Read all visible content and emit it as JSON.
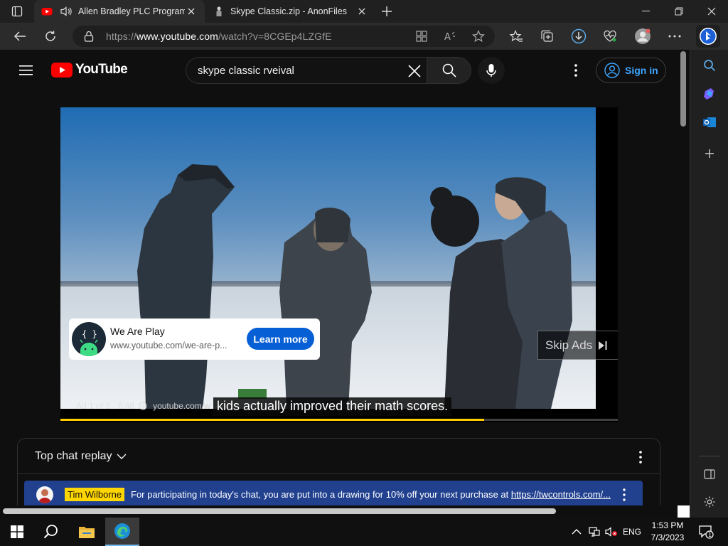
{
  "browser": {
    "tabs": [
      {
        "title": "Allen Bradley PLC Programmi",
        "active": true,
        "audio": true
      },
      {
        "title": "Skype Classic.zip - AnonFiles",
        "active": false
      }
    ],
    "url": {
      "scheme": "https://",
      "host": "www.youtube.com",
      "path": "/watch?v=8CGEp4LZGfE"
    }
  },
  "youtube": {
    "logo_text": "YouTube",
    "search_query": "skype classic rveival",
    "signin_label": "Sign in"
  },
  "player": {
    "ad_card": {
      "name": "We Are Play",
      "link": "www.youtube.com/we-are-p...",
      "button": "Learn more"
    },
    "skip_label": "Skip Ads",
    "ad_counter": "Ad 1 of 2 · 0:46",
    "ad_domain": "youtube.com/w",
    "caption": "kids actually improved their math scores.",
    "progress_fraction": 0.76
  },
  "chat": {
    "header": "Top chat replay",
    "pinned": {
      "author": "Tim Wilborne",
      "message": "For participating in today's chat, you are put into a drawing for 10% off your next purchase at ",
      "link": "https://twcontrols.com/..."
    }
  },
  "taskbar": {
    "lang": "ENG",
    "time": "1:53 PM",
    "date": "7/3/2023",
    "notification_count": "1"
  },
  "colors": {
    "accent": "#3ea6ff",
    "yt_red": "#ff0000",
    "progress": "#ffcc00",
    "pinned_bg": "#21418f",
    "learn_more": "#065fd4"
  }
}
